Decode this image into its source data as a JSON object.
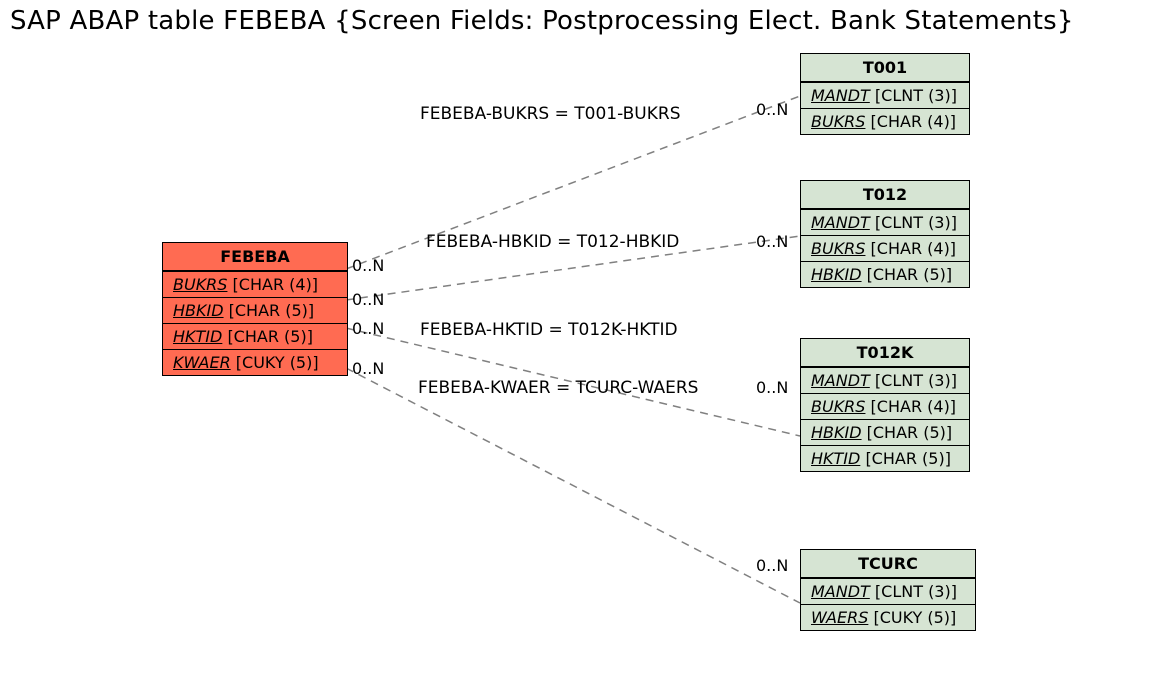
{
  "title": "SAP ABAP table FEBEBA {Screen Fields: Postprocessing Elect. Bank Statements}",
  "source": {
    "name": "FEBEBA",
    "fields": [
      {
        "name": "BUKRS",
        "type": "[CHAR (4)]",
        "key": true
      },
      {
        "name": "HBKID",
        "type": "[CHAR (5)]",
        "key": true
      },
      {
        "name": "HKTID",
        "type": "[CHAR (5)]",
        "key": true
      },
      {
        "name": "KWAER",
        "type": "[CUKY (5)]",
        "key": true
      }
    ]
  },
  "targets": [
    {
      "name": "T001",
      "fields": [
        {
          "name": "MANDT",
          "type": "[CLNT (3)]",
          "key": true
        },
        {
          "name": "BUKRS",
          "type": "[CHAR (4)]",
          "key": true
        }
      ]
    },
    {
      "name": "T012",
      "fields": [
        {
          "name": "MANDT",
          "type": "[CLNT (3)]",
          "key": true
        },
        {
          "name": "BUKRS",
          "type": "[CHAR (4)]",
          "key": true
        },
        {
          "name": "HBKID",
          "type": "[CHAR (5)]",
          "key": true
        }
      ]
    },
    {
      "name": "T012K",
      "fields": [
        {
          "name": "MANDT",
          "type": "[CLNT (3)]",
          "key": true
        },
        {
          "name": "BUKRS",
          "type": "[CHAR (4)]",
          "key": true
        },
        {
          "name": "HBKID",
          "type": "[CHAR (5)]",
          "key": true
        },
        {
          "name": "HKTID",
          "type": "[CHAR (5)]",
          "key": true
        }
      ]
    },
    {
      "name": "TCURC",
      "fields": [
        {
          "name": "MANDT",
          "type": "[CLNT (3)]",
          "key": true
        },
        {
          "name": "WAERS",
          "type": "[CUKY (5)]",
          "key": true
        }
      ]
    }
  ],
  "relations": [
    {
      "label": "FEBEBA-BUKRS = T001-BUKRS",
      "src_card": "0..N",
      "dst_card": "0..N"
    },
    {
      "label": "FEBEBA-HBKID = T012-HBKID",
      "src_card": "0..N",
      "dst_card": "0..N"
    },
    {
      "label": "FEBEBA-HKTID = T012K-HKTID",
      "src_card": "0..N",
      "dst_card": "0..N"
    },
    {
      "label": "FEBEBA-KWAER = TCURC-WAERS",
      "src_card": "0..N",
      "dst_card": "0..N"
    }
  ]
}
